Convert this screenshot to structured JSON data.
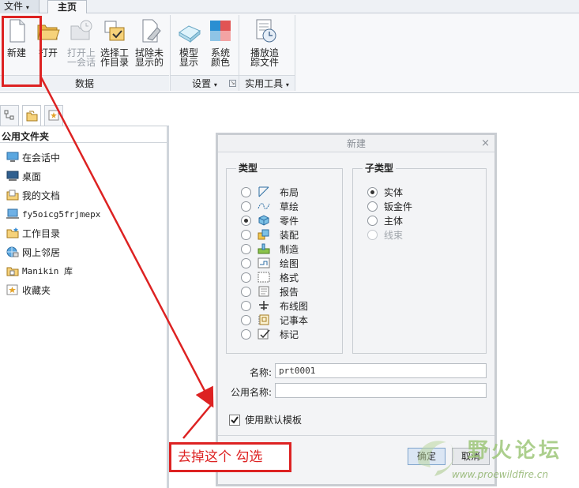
{
  "tabs": {
    "file": "文件",
    "home": "主页"
  },
  "ribbon": {
    "buttons": {
      "new": "新建",
      "open": "打开",
      "open_session": "打开上\n一会话",
      "select_dir": "选择工\n作目录",
      "erase": "拭除未\n显示的",
      "model_display": "模型\n显示",
      "system_colors": "系统\n颜色",
      "playback": "播放追\n踪文件"
    },
    "groups": {
      "data": "数据",
      "settings": "设置",
      "utilities": "实用工具"
    }
  },
  "navigator": {
    "title": "公用文件夹",
    "items": [
      {
        "label": "在会话中",
        "icon": "monitor-icon"
      },
      {
        "label": "桌面",
        "icon": "desktop-icon"
      },
      {
        "label": "我的文档",
        "icon": "documents-icon"
      },
      {
        "label": "fy5oicg5frjmepx",
        "icon": "computer-icon"
      },
      {
        "label": "工作目录",
        "icon": "working-directory-icon"
      },
      {
        "label": "网上邻居",
        "icon": "network-icon"
      },
      {
        "label": "Manikin 库",
        "icon": "library-icon"
      },
      {
        "label": "收藏夹",
        "icon": "favorites-icon"
      }
    ]
  },
  "dialog": {
    "title": "新建",
    "close": "×",
    "type_legend": "类型",
    "types": [
      {
        "label": "布局",
        "checked": false
      },
      {
        "label": "草绘",
        "checked": false
      },
      {
        "label": "零件",
        "checked": true
      },
      {
        "label": "装配",
        "checked": false
      },
      {
        "label": "制造",
        "checked": false
      },
      {
        "label": "绘图",
        "checked": false
      },
      {
        "label": "格式",
        "checked": false
      },
      {
        "label": "报告",
        "checked": false
      },
      {
        "label": "布线图",
        "checked": false
      },
      {
        "label": "记事本",
        "checked": false
      },
      {
        "label": "标记",
        "checked": false
      }
    ],
    "subtype_legend": "子类型",
    "subtypes": [
      {
        "label": "实体",
        "checked": true,
        "disabled": false
      },
      {
        "label": "钣金件",
        "checked": false,
        "disabled": false
      },
      {
        "label": "主体",
        "checked": false,
        "disabled": false
      },
      {
        "label": "线束",
        "checked": false,
        "disabled": true
      }
    ],
    "name_label": "名称:",
    "name_value": "prt0001",
    "common_name_label": "公用名称:",
    "common_name_value": "",
    "use_template_label": "使用默认模板",
    "use_template_checked": true,
    "ok": "确定",
    "cancel": "取消"
  },
  "annotation": {
    "text": "去掉这个 勾选",
    "color": "#dd2222"
  },
  "watermark": {
    "title": "野火论坛",
    "url": "www.proewildfire.cn"
  }
}
